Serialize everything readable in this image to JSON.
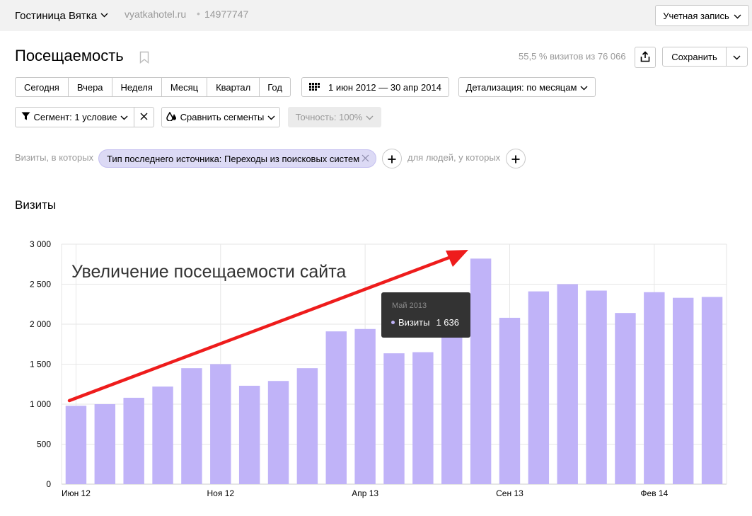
{
  "header": {
    "site_name": "Гостиница Вятка",
    "site_domain": "vyatkahotel.ru",
    "separator": "•",
    "counter_id": "14977747",
    "account_button": "Учетная запись"
  },
  "report": {
    "title": "Посещаемость",
    "visits_share": "55,5 % визитов из 76 066",
    "save_button": "Сохранить"
  },
  "period_tabs": [
    "Сегодня",
    "Вчера",
    "Неделя",
    "Месяц",
    "Квартал",
    "Год"
  ],
  "date_range": "1 июн 2012 — 30 апр 2014",
  "detail": "Детализация: по месяцам",
  "segment": {
    "label": "Сегмент: 1 условие",
    "compare": "Сравнить сегменты",
    "accuracy": "Точность: 100%"
  },
  "filters": {
    "visits_prefix": "Визиты, в которых",
    "chip": "Тип последнего источника: Переходы из поисковых систем",
    "people_prefix": "для людей, у которых"
  },
  "chart_section_title": "Визиты",
  "annotation": "Увеличение посещаемости сайта",
  "tooltip": {
    "title": "Май 2013",
    "series": "Визиты",
    "value": "1 636"
  },
  "colors": {
    "bar": "#c0b3f8",
    "arrow": "#ee1c1c",
    "grid": "#e6e6e6",
    "tooltip_bg": "#333333"
  },
  "chart_data": {
    "type": "bar",
    "categories": [
      "Июн 12",
      "Июл 12",
      "Авг 12",
      "Сен 12",
      "Окт 12",
      "Ноя 12",
      "Дек 12",
      "Янв 13",
      "Фев 13",
      "Мар 13",
      "Апр 13",
      "Май 13",
      "Июн 13",
      "Июл 13",
      "Авг 13",
      "Сен 13",
      "Окт 13",
      "Ноя 13",
      "Дек 13",
      "Янв 14",
      "Фев 14",
      "Мар 14",
      "Апр 14"
    ],
    "series": [
      {
        "name": "Визиты",
        "values": [
          980,
          1000,
          1080,
          1220,
          1450,
          1500,
          1230,
          1290,
          1450,
          1910,
          1940,
          1636,
          1650,
          2250,
          2820,
          2080,
          2410,
          2500,
          2420,
          2140,
          2400,
          2330,
          2340
        ]
      }
    ],
    "x_tick_labels": [
      "Июн 12",
      "Ноя 12",
      "Апр 13",
      "Сен 13",
      "Фев 14"
    ],
    "y_ticks": [
      0,
      500,
      1000,
      1500,
      2000,
      2500,
      3000
    ],
    "y_tick_labels": [
      "0",
      "500",
      "1 000",
      "1 500",
      "2 000",
      "2 500",
      "3 000"
    ],
    "ylim": [
      0,
      3000
    ],
    "grid": true,
    "title": "",
    "xlabel": "",
    "ylabel": ""
  }
}
